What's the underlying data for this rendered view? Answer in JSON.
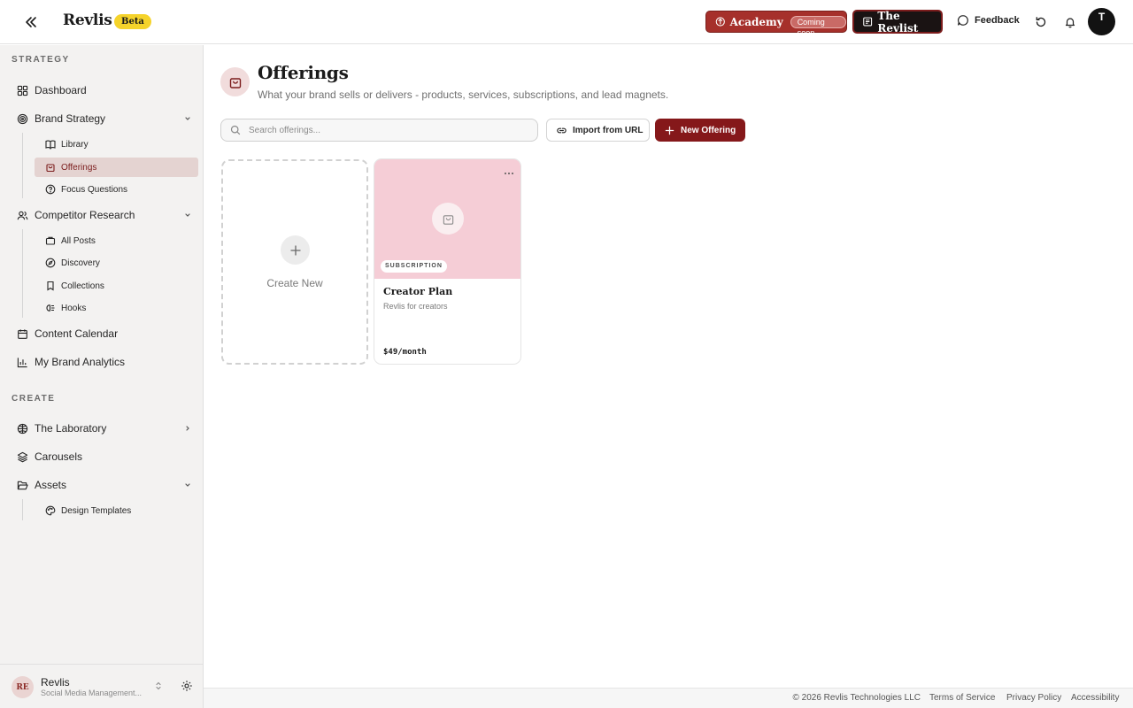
{
  "header": {
    "brand": "Revlis",
    "beta_label": "Beta",
    "academy_label": "Academy",
    "coming_soon": "Coming soon",
    "revlist_label": "The Revlist",
    "feedback_label": "Feedback",
    "avatar_initial": "T",
    "accent_color": "#a6302b"
  },
  "sidebar": {
    "strategy_label": "STRATEGY",
    "create_label": "CREATE",
    "items": {
      "dashboard": "Dashboard",
      "brand_strategy": "Brand Strategy",
      "library": "Library",
      "offerings": "Offerings",
      "focus_questions": "Focus Questions",
      "competitor_research": "Competitor Research",
      "all_posts": "All Posts",
      "discovery": "Discovery",
      "collections": "Collections",
      "hooks": "Hooks",
      "content_calendar": "Content Calendar",
      "my_brand_analytics": "My Brand Analytics",
      "the_laboratory": "The Laboratory",
      "carousels": "Carousels",
      "assets": "Assets",
      "design_templates": "Design Templates"
    },
    "workspace": {
      "initials": "RE",
      "name": "Revlis",
      "subtitle": "Social Media Management..."
    }
  },
  "main": {
    "title": "Offerings",
    "subtitle": "What your brand sells or delivers - products, services, subscriptions, and lead magnets.",
    "search_placeholder": "Search offerings...",
    "import_label": "Import from URL",
    "new_label": "New Offering",
    "create_new_label": "Create New",
    "offerings": [
      {
        "type": "SUBSCRIPTION",
        "name": "Creator Plan",
        "description": "Revlis for creators",
        "price": "$49/month",
        "color": "#f5cdd6"
      }
    ]
  },
  "footer": {
    "copyright": "© 2026 Revlis Technologies LLC",
    "terms": "Terms of Service",
    "privacy": "Privacy Policy",
    "accessibility": "Accessibility"
  }
}
